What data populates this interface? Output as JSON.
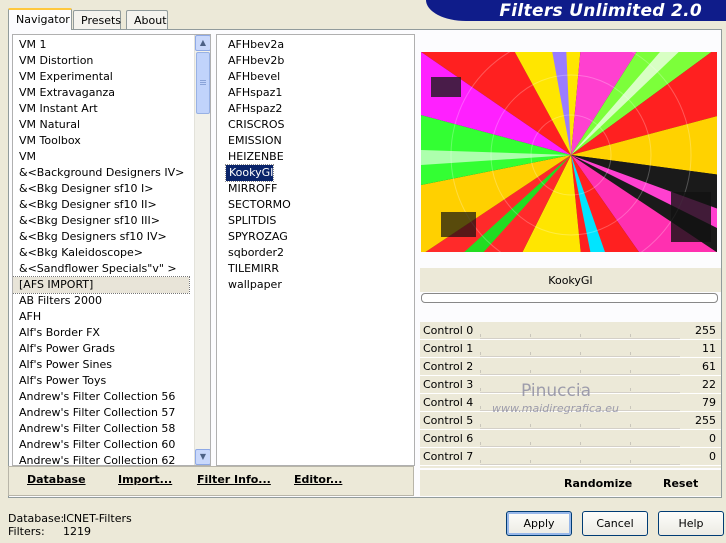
{
  "tabs": [
    "Navigator",
    "Presets",
    "About"
  ],
  "banner": "Filters Unlimited 2.0",
  "categories": [
    "VM 1",
    "VM Distortion",
    "VM Experimental",
    "VM Extravaganza",
    "VM Instant Art",
    "VM Natural",
    "VM Toolbox",
    "VM",
    "&<Background Designers IV>",
    "&<Bkg Designer sf10 I>",
    "&<Bkg Designer sf10 II>",
    "&<Bkg Designer sf10 III>",
    "&<Bkg Designers sf10 IV>",
    "&<Bkg Kaleidoscope>",
    "&<Sandflower Specials\"v\" >",
    "[AFS IMPORT]",
    "AB Filters 2000",
    "AFH",
    "Alf's Border FX",
    "Alf's Power Grads",
    "Alf's Power Sines",
    "Alf's Power Toys",
    "Andrew's Filter Collection 56",
    "Andrew's Filter Collection 57",
    "Andrew's Filter Collection 58",
    "Andrew's Filter Collection 60",
    "Andrew's Filter Collection 62"
  ],
  "selected_category": "[AFS IMPORT]",
  "filters": [
    "AFHbev2a",
    "AFHbev2b",
    "AFHbevel",
    "AFHspaz1",
    "AFHspaz2",
    "CRISCROS",
    "EMISSION",
    "HEIZENBE",
    "KookyGI",
    "MIRROFF",
    "SECTORMO",
    "SPLITDIS",
    "SPYROZAG",
    "sqborder2",
    "TILEMIRR",
    "wallpaper"
  ],
  "selected_filter": "KookyGI",
  "bottom_buttons": {
    "database": "Database",
    "import": "Import...",
    "filter_info": "Filter Info...",
    "editor": "Editor..."
  },
  "filter_name": "KookyGI",
  "controls": [
    {
      "label": "Control 0",
      "value": "255"
    },
    {
      "label": "Control 1",
      "value": "11"
    },
    {
      "label": "Control 2",
      "value": "61"
    },
    {
      "label": "Control 3",
      "value": "22"
    },
    {
      "label": "Control 4",
      "value": "79"
    },
    {
      "label": "Control 5",
      "value": "255"
    },
    {
      "label": "Control 6",
      "value": "0"
    },
    {
      "label": "Control 7",
      "value": "0"
    }
  ],
  "right_buttons": {
    "randomize": "Randomize",
    "reset": "Reset"
  },
  "watermark": {
    "name": "Pinuccia",
    "url": "www.maidiregrafica.eu"
  },
  "footer": {
    "database_label": "Database:",
    "database_value": "ICNET-Filters",
    "filters_label": "Filters:",
    "filters_value": "1219"
  },
  "dialog_buttons": {
    "apply": "Apply",
    "cancel": "Cancel",
    "help": "Help"
  }
}
